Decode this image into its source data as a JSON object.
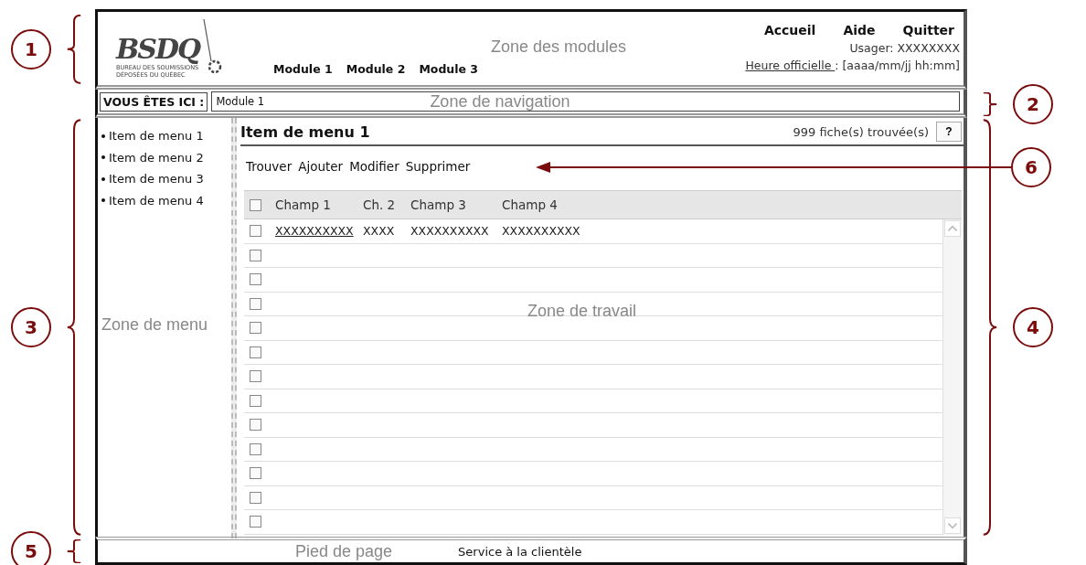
{
  "header": {
    "annotation": "1",
    "logo": {
      "wordmark": "BSDQ",
      "subtitle_lines": [
        "BUREAU DES SOUMISSIONS",
        "DÉPOSÉES DU QUÉBEC"
      ]
    },
    "zone_label": "Zone des modules",
    "modules": [
      "Module 1",
      "Module 2",
      "Module 3"
    ],
    "links": [
      "Accueil",
      "Aide",
      "Quitter"
    ],
    "user": "Usager: XXXXXXXX",
    "clock_link": "Heure officielle ",
    "clock_value": ": [aaaa/mm/jj hh:mm]"
  },
  "nav": {
    "annotation": "2",
    "label": "VOUS ÊTES ICI :",
    "breadcrumb": "Module 1",
    "zone_label": "Zone de navigation"
  },
  "menu": {
    "annotation": "3",
    "items": [
      "Item de menu 1",
      "Item de menu 2",
      "Item de menu 3",
      "Item de menu 4"
    ],
    "zone_label": "Zone de menu"
  },
  "work": {
    "annotation": "4",
    "title": "Item de menu 1",
    "count": "999 fiche(s) trouvée(s)",
    "help": "?",
    "toolbar_annotation": "6",
    "actions": [
      "Trouver",
      "Ajouter",
      "Modifier",
      "Supprimer"
    ],
    "zone_label": "Zone de travail",
    "table": {
      "columns": [
        "Champ 1",
        "Ch. 2",
        "Champ 3",
        "Champ 4"
      ],
      "header_checked": false,
      "rows": [
        {
          "checked": false,
          "cells": [
            "XXXXXXXXXX",
            "XXXX",
            "XXXXXXXXXX",
            "XXXXXXXXXX"
          ]
        },
        {
          "checked": false
        },
        {
          "checked": false
        },
        {
          "checked": false
        },
        {
          "checked": false
        },
        {
          "checked": false
        },
        {
          "checked": false
        },
        {
          "checked": false
        },
        {
          "checked": false
        },
        {
          "checked": false
        },
        {
          "checked": false
        },
        {
          "checked": false
        },
        {
          "checked": false
        }
      ]
    }
  },
  "footer": {
    "annotation": "5",
    "zone_label": "Pied de page",
    "link": "Service à la clientèle"
  }
}
